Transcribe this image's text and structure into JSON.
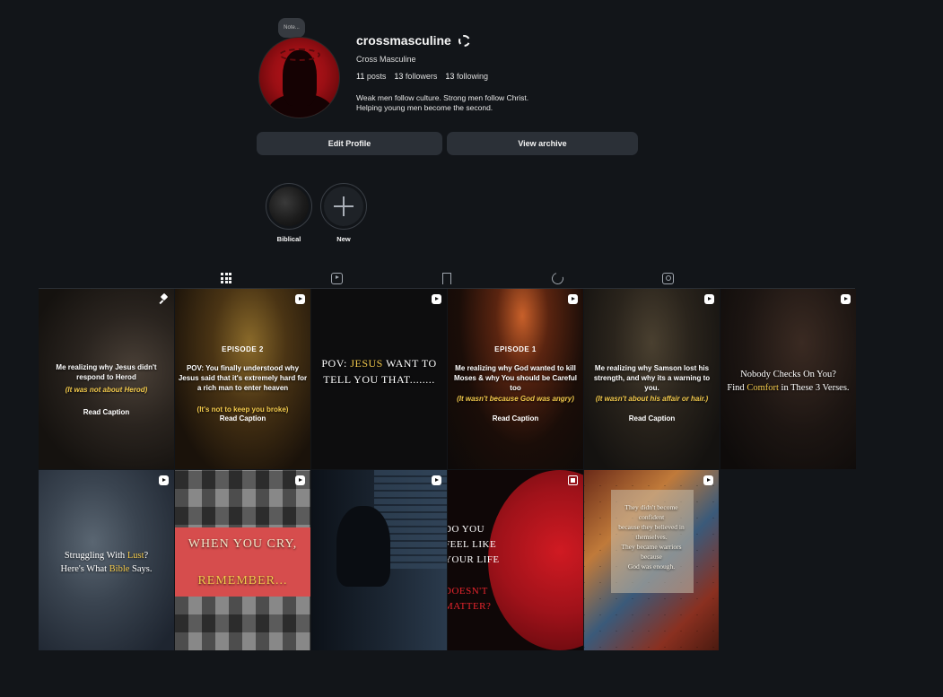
{
  "profile": {
    "note": "Note...",
    "username": "crossmasculine",
    "display_name": "Cross Masculine",
    "posts_count": "11",
    "posts_label": "posts",
    "followers_count": "13",
    "followers_label": "followers",
    "following_count": "13",
    "following_label": "following",
    "bio_line1": "Weak men follow culture. Strong men follow Christ.",
    "bio_line2": "Helping young men become the second.",
    "edit_profile_label": "Edit Profile",
    "view_archive_label": "View archive"
  },
  "highlights": [
    {
      "label": "Biblical"
    },
    {
      "label": "New"
    }
  ],
  "tabs": [
    {
      "name": "posts",
      "icon": "grid-icon",
      "active": true
    },
    {
      "name": "reels",
      "icon": "reels-icon"
    },
    {
      "name": "saved",
      "icon": "bookmark-icon"
    },
    {
      "name": "reposts",
      "icon": "repost-icon"
    },
    {
      "name": "tagged",
      "icon": "tagged-icon"
    }
  ],
  "posts": [
    {
      "badge": "pin-icon",
      "line1": "Me realizing why Jesus didn't respond to Herod",
      "line2": "(It was not about Herod)",
      "caption": "Read Caption"
    },
    {
      "badge": "reel-icon",
      "episode": "EPISODE 2",
      "line1": "POV: You finally understood why Jesus said that it's extremely hard for a rich man to enter heaven",
      "line2": "(It's not to keep you broke)",
      "caption": "Read Caption"
    },
    {
      "badge": "reel-icon",
      "text_pre": "POV: ",
      "text_hl": "JESUS",
      "text_post": " WANT TO TELL YOU THAT........"
    },
    {
      "badge": "reel-icon",
      "episode": "EPISODE 1",
      "line1": "Me realizing why God wanted to kill Moses & why You should be Careful too",
      "line2": "(It wasn't because God was angry)",
      "caption": "Read Caption"
    },
    {
      "badge": "reel-icon",
      "line1": "Me realizing why Samson lost his strength, and why its a warning to you.",
      "line2": "(It wasn't about his affair or hair.)",
      "caption": "Read Caption"
    },
    {
      "badge": "reel-icon",
      "t1": "Nobody Checks On You?",
      "t2": "Find ",
      "t2hl": "Comfort",
      "t3": " in These 3 Verses."
    },
    {
      "badge": "reel-icon",
      "t1": "Struggling With ",
      "t1hl": "Lust",
      "t1b": "?",
      "t2": "Here's What ",
      "t2hl": "Bible",
      "t2b": " Says."
    },
    {
      "badge": "reel-icon",
      "line1": "WHEN YOU CRY,",
      "line2": "REMEMBER..."
    },
    {
      "badge": "reel-icon"
    },
    {
      "badge": "carousel-icon",
      "l1": "DO YOU",
      "l2": "FEEL LIKE",
      "l3": "YOUR LIFE",
      "l4": "DOESN'T",
      "l5": "MATTER?"
    },
    {
      "badge": "reel-icon",
      "q1": "They didn't become",
      "q2": "confident",
      "q3": "because they believed in",
      "q4": "themselves.",
      "q5": "They became warriors",
      "q6": "because",
      "q7": "God was enough."
    }
  ]
}
